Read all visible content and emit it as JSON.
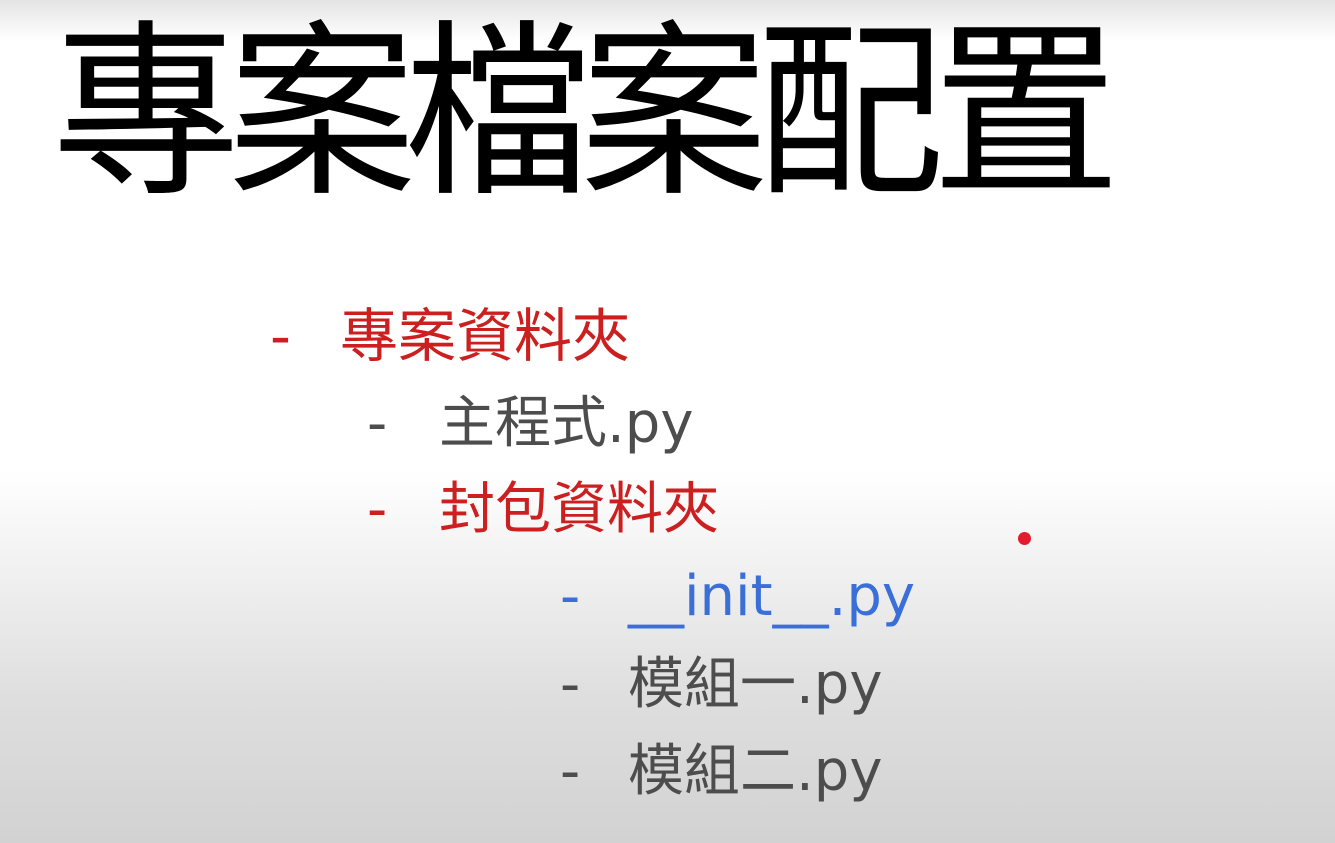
{
  "slide": {
    "title": "專案檔案配置"
  },
  "outline": [
    {
      "bullet": "-",
      "text": "專案資料夾",
      "color": "#cc1f1f",
      "level": 1
    },
    {
      "bullet": "-",
      "text": "主程式.py",
      "color": "#4d4d4d",
      "level": 2
    },
    {
      "bullet": "-",
      "text": "封包資料夾",
      "color": "#cc1f1f",
      "level": 2
    },
    {
      "bullet": "-",
      "text": "__init__.py",
      "color": "#3a6fd8",
      "level": 3
    },
    {
      "bullet": "-",
      "text": "模組一.py",
      "color": "#4d4d4d",
      "level": 3
    },
    {
      "bullet": "-",
      "text": "模組二.py",
      "color": "#4d4d4d",
      "level": 3
    }
  ],
  "colors": {
    "folder": "#cc1f1f",
    "file": "#4d4d4d",
    "highlight": "#3a6fd8",
    "laser": "#e31b2c"
  }
}
